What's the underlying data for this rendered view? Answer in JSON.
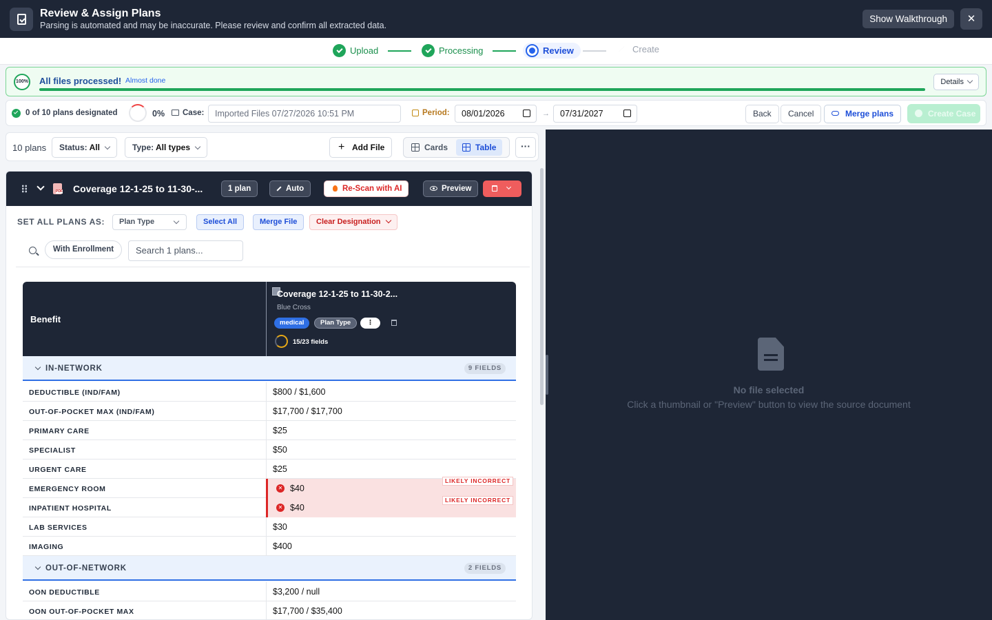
{
  "header": {
    "title": "Review & Assign Plans",
    "subtitle": "Parsing is automated and may be inaccurate. Please review and confirm all extracted data.",
    "walkthrough_label": "Show Walkthrough",
    "close_label": "✕"
  },
  "stepper": {
    "steps": [
      {
        "label": "Upload",
        "state": "done"
      },
      {
        "label": "Processing",
        "state": "done"
      },
      {
        "label": "Review",
        "state": "current"
      },
      {
        "label": "Create",
        "state": "pending"
      }
    ]
  },
  "banner": {
    "progress_text": "100%",
    "progress": 1.0,
    "title": "All files processed!",
    "badge": "Almost done",
    "details_label": "Details"
  },
  "toolbar": {
    "designated": "0 of 10 plans designated",
    "percent": "0%",
    "case_label": "Case:",
    "case_value": "Imported Files 07/27/2026 10:51 PM",
    "period_label": "Period:",
    "period_start": "08/01/2026",
    "period_end": "07/31/2027",
    "back_label": "Back",
    "cancel_label": "Cancel",
    "merge_label": "Merge plans",
    "create_label": "Create Case"
  },
  "filters": {
    "count": "10 plans",
    "status_label": "Status:",
    "status_value": "All",
    "type_label": "Type:",
    "type_value": "All types",
    "add_file_label": "Add File",
    "cards_label": "Cards",
    "table_label": "Table",
    "more_label": "···"
  },
  "file_card": {
    "title": "Coverage 12-1-25 to 11-30-...",
    "plan_count": "1 plan",
    "auto_label": "Auto",
    "rescan_label": "Re-Scan with AI",
    "preview_label": "Preview",
    "set_all_label": "SET ALL PLANS AS:",
    "plan_type_select": "Plan Type",
    "select_all_label": "Select All",
    "merge_file_label": "Merge File",
    "clear_designation_label": "Clear Designation",
    "enrollment_label": "With Enrollment",
    "search_placeholder": "Search 1 plans..."
  },
  "table": {
    "benefit_header": "Benefit",
    "plan": {
      "name": "Coverage 12-1-25 to 11-30-2...",
      "carrier": "Blue Cross",
      "type_tag": "medical",
      "plan_type_tag": "Plan Type",
      "fields": "15/23 fields",
      "fields_fraction": 0.652
    },
    "sections": [
      {
        "name": "IN-NETWORK",
        "count": "9 FIELDS",
        "rows": [
          {
            "label": "DEDUCTIBLE (IND/FAM)",
            "value": "$800 / $1,600"
          },
          {
            "label": "OUT-OF-POCKET MAX (IND/FAM)",
            "value": "$17,700 / $17,700"
          },
          {
            "label": "PRIMARY CARE",
            "value": "$25"
          },
          {
            "label": "SPECIALIST",
            "value": "$50"
          },
          {
            "label": "URGENT CARE",
            "value": "$25"
          },
          {
            "label": "EMERGENCY ROOM",
            "value": "$40",
            "flag": "LIKELY INCORRECT"
          },
          {
            "label": "INPATIENT HOSPITAL",
            "value": "$40",
            "flag": "LIKELY INCORRECT"
          },
          {
            "label": "LAB SERVICES",
            "value": "$30"
          },
          {
            "label": "IMAGING",
            "value": "$400"
          }
        ]
      },
      {
        "name": "OUT-OF-NETWORK",
        "count": "2 FIELDS",
        "rows": [
          {
            "label": "OON DEDUCTIBLE",
            "value": "$3,200 / null"
          },
          {
            "label": "OON OUT-OF-POCKET MAX",
            "value": "$17,700 / $35,400"
          }
        ]
      }
    ]
  },
  "viewer": {
    "empty_title": "No file selected",
    "empty_sub": "Click a thumbnail or \"Preview\" button to view the source document"
  }
}
